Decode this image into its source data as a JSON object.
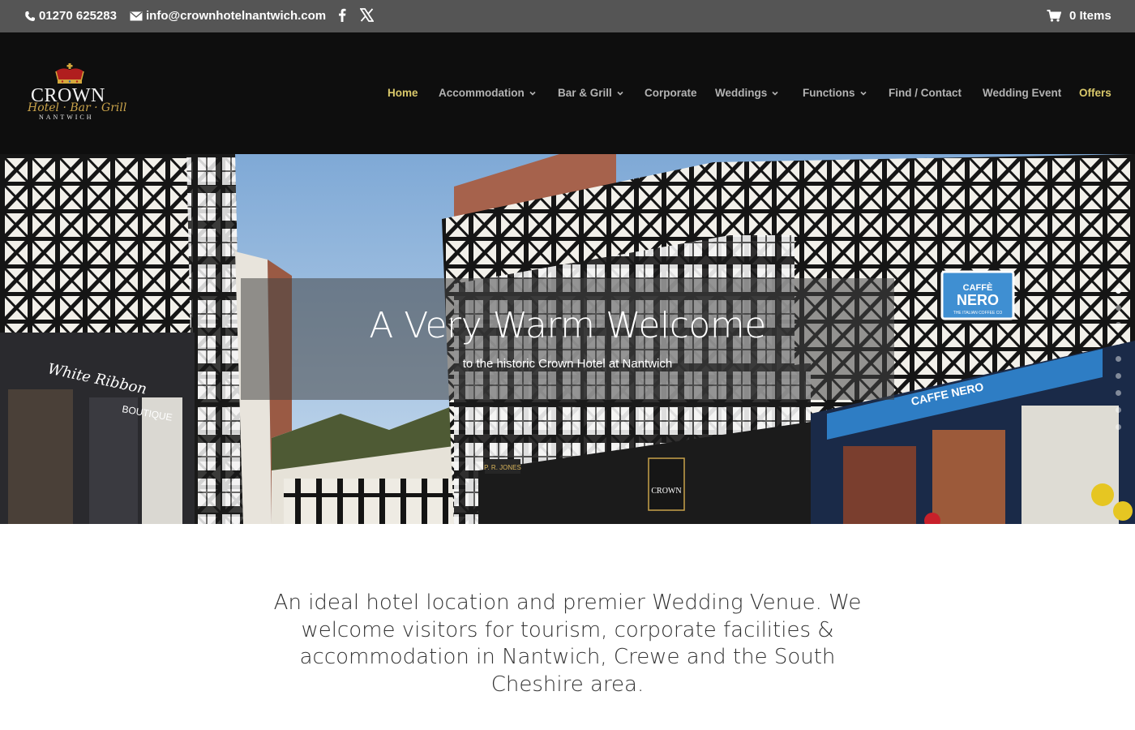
{
  "topbar": {
    "phone": "01270 625283",
    "email": "info@crownhotelnantwich.com",
    "cart": "0 Items"
  },
  "logo": {
    "name": "CROWN",
    "script": "Hotel · Bar · Grill",
    "location": "NANTWICH"
  },
  "nav": {
    "items": [
      {
        "label": "Home",
        "caret": false
      },
      {
        "label": "Accommodation",
        "caret": true
      },
      {
        "label": "Bar & Grill",
        "caret": true
      },
      {
        "label": "Corporate",
        "caret": false
      },
      {
        "label": "Weddings",
        "caret": true
      },
      {
        "label": "Functions",
        "caret": true
      },
      {
        "label": "Find / Contact",
        "caret": false
      },
      {
        "label": "Wedding Event",
        "caret": false
      },
      {
        "label": "Offers",
        "caret": false
      }
    ]
  },
  "hero": {
    "title": "A Very Warm Welcome",
    "subtitle": "to the historic Crown Hotel at Nantwich",
    "slides": 9,
    "active_slide": 1,
    "signs": {
      "cafe_top": "CAFFÈ",
      "cafe_name": "NERO",
      "cafe_tag": "THE ITALIAN COFFEE CO",
      "cafe_fascia": "CAFFE NERO",
      "boutique_script": "White Ribbon",
      "boutique": "BOUTIQUE",
      "crown_sign": "CROWN",
      "jones": "P. R. JONES"
    }
  },
  "intro": {
    "text": "An ideal hotel location and premier Wedding Venue. We welcome visitors for tourism, corporate facilities & accommodation in Nantwich, Crewe and the South Cheshire area."
  },
  "colors": {
    "topbar_bg": "#555555",
    "header_bg": "#0e0e0e",
    "nav_text": "#b3b3b3",
    "nav_accent": "#d9c86a",
    "body_text": "#333333"
  }
}
